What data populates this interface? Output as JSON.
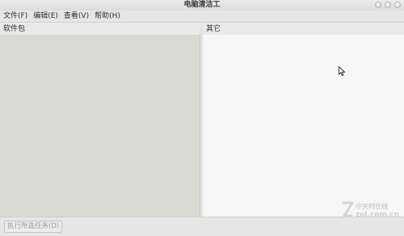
{
  "window": {
    "title": "电脑清洁工"
  },
  "menu": [
    {
      "label": "文件(F)"
    },
    {
      "label": "编辑(E)"
    },
    {
      "label": "查看(V)"
    },
    {
      "label": "帮助(H)"
    }
  ],
  "panes": {
    "left_header": "软件包",
    "right_header": "其它"
  },
  "footer": {
    "execute_button": "执行所选任务(D)"
  },
  "watermark": {
    "brand": "中关村在线",
    "url": "zol.com.cn"
  },
  "colors": {
    "left_pane_bg": "#d8d9d2",
    "right_pane_bg": "#f6f6f6"
  },
  "icons": [
    "minimize-button-icon",
    "maximize-button-icon",
    "close-button-icon",
    "mouse-pointer-icon",
    "zol-logo-icon"
  ]
}
